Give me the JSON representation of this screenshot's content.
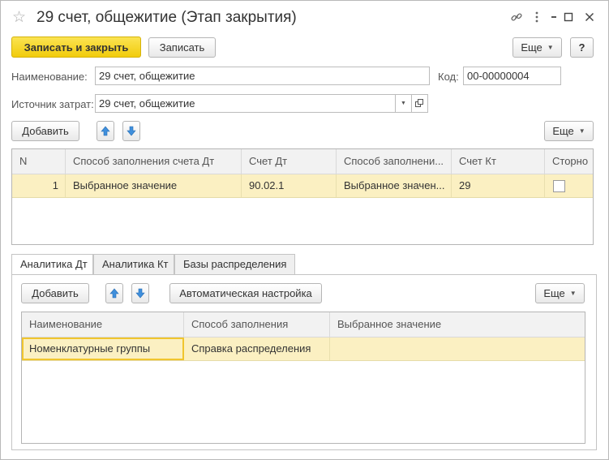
{
  "window": {
    "title": "29 счет, общежитие (Этап закрытия)",
    "icons": [
      "star-icon",
      "link-icon",
      "more-icon",
      "maximize-icon",
      "close-icon"
    ]
  },
  "toolbar": {
    "save_close_label": "Записать и закрыть",
    "save_label": "Записать",
    "more_label": "Еще",
    "help_label": "?"
  },
  "form": {
    "name_label": "Наименование:",
    "name_value": "29 счет, общежитие",
    "code_label": "Код:",
    "code_value": "00-00000004",
    "source_label": "Источник затрат:",
    "source_value": "29 счет, общежитие"
  },
  "main_table": {
    "add_label": "Добавить",
    "more_label": "Еще",
    "columns": [
      "N",
      "Способ заполнения счета Дт",
      "Счет Дт",
      "Способ заполнени...",
      "Счет Кт",
      "Сторно"
    ],
    "rows": [
      {
        "n": "1",
        "dt_fill": "Выбранное значение",
        "dt_account": "90.02.1",
        "kt_fill": "Выбранное значен...",
        "kt_account": "29",
        "storno": false
      }
    ]
  },
  "tabs": [
    {
      "label": "Аналитика Дт",
      "active": true
    },
    {
      "label": "Аналитика Кт",
      "active": false
    },
    {
      "label": "Базы распределения",
      "active": false
    }
  ],
  "analytics": {
    "add_label": "Добавить",
    "auto_setup_label": "Автоматическая настройка",
    "more_label": "Еще",
    "columns": [
      "Наименование",
      "Способ заполнения",
      "Выбранное значение"
    ],
    "rows": [
      {
        "name": "Номенклатурные группы",
        "fill_method": "Справка распределения",
        "value": ""
      }
    ]
  },
  "colors": {
    "primary_button": "#f5d21f",
    "selected_row": "#fbf0c2",
    "arrow_blue": "#3f8fdc"
  }
}
